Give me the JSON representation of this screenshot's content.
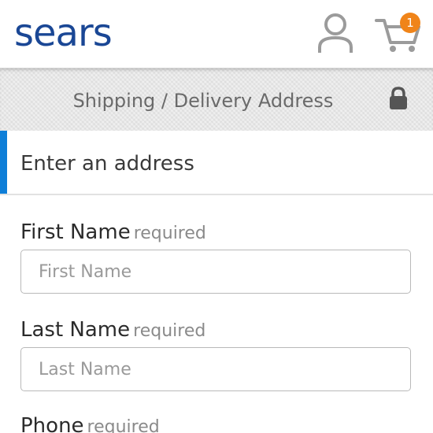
{
  "header": {
    "logo_text": "sears",
    "brand_color": "#1a4795",
    "account_icon": "user-icon",
    "cart_icon": "cart-icon",
    "cart_count": "1",
    "badge_color": "#f08419"
  },
  "section": {
    "title": "Shipping / Delivery Address",
    "lock_icon": "lock-icon"
  },
  "address_tab": {
    "label": "Enter an address",
    "accent_color": "#0e7ed8"
  },
  "form": {
    "first_name": {
      "label": "First Name",
      "required_text": "required",
      "placeholder": "First Name",
      "value": ""
    },
    "last_name": {
      "label": "Last Name",
      "required_text": "required",
      "placeholder": "Last Name",
      "value": ""
    },
    "phone": {
      "label": "Phone",
      "required_text": "required"
    }
  }
}
